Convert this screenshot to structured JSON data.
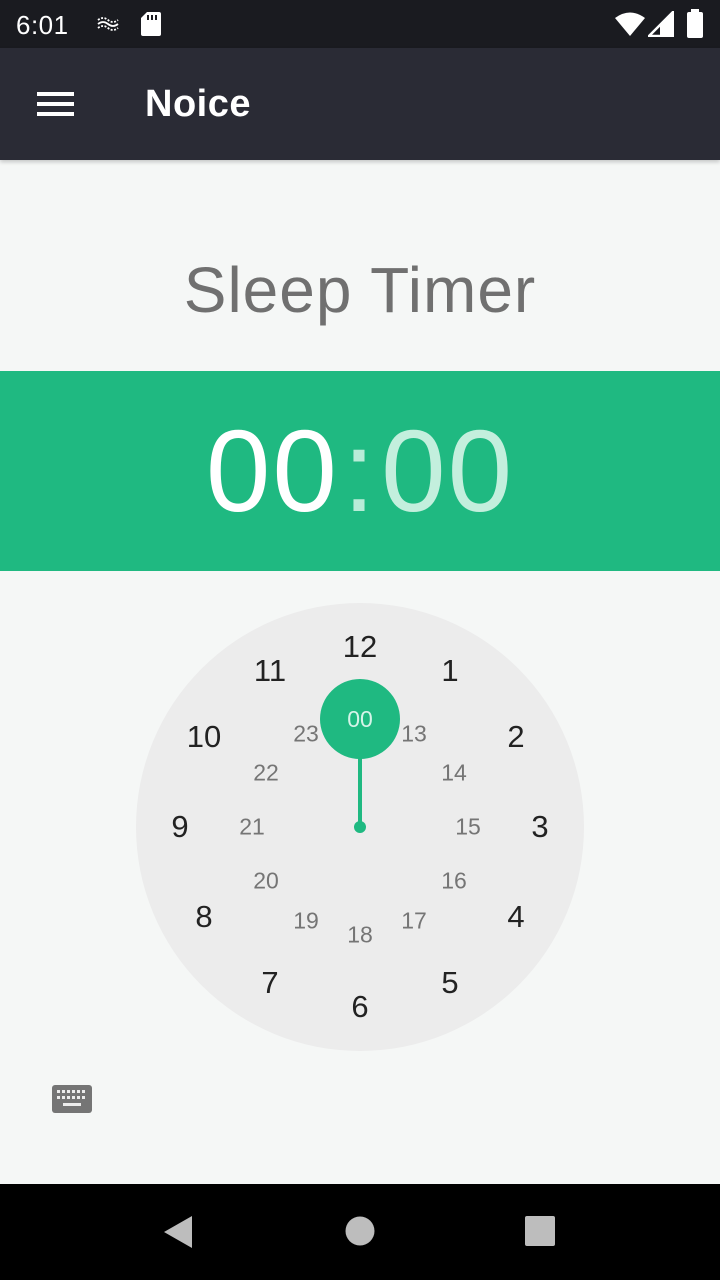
{
  "status_bar": {
    "time": "6:01",
    "icons": [
      "noise-app-icon",
      "sd-card-icon",
      "wifi-icon",
      "cell-signal-icon",
      "battery-icon"
    ]
  },
  "app_bar": {
    "menu_icon": "hamburger-menu-icon",
    "title": "Noice"
  },
  "timer": {
    "title": "Sleep Timer",
    "hours": "00",
    "separator": ":",
    "minutes": "00"
  },
  "clock": {
    "selected_value": "00",
    "outer_ring": [
      "12",
      "1",
      "2",
      "3",
      "4",
      "5",
      "6",
      "7",
      "8",
      "9",
      "10",
      "11"
    ],
    "inner_ring": [
      "00",
      "13",
      "14",
      "15",
      "16",
      "17",
      "18",
      "19",
      "20",
      "21",
      "22",
      "23"
    ]
  },
  "input_mode_icon": "keyboard-icon",
  "nav_bar": {
    "buttons": [
      "back-icon",
      "home-icon",
      "recents-icon"
    ]
  },
  "colors": {
    "accent": "#1fb981",
    "app_bar": "#2a2b35",
    "status_bar": "#1a1b20",
    "clock_face": "#ececec",
    "background": "#f5f7f6"
  }
}
